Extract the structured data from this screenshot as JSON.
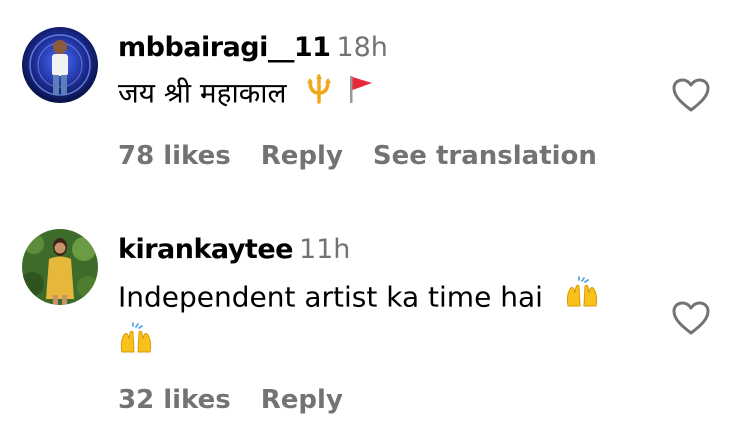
{
  "comments": [
    {
      "username": "mbbairagi__11",
      "time": "18h",
      "text": "जय श्री महाकाल",
      "likes": "78 likes",
      "reply": "Reply",
      "translate": "See translation",
      "emojis": [
        "trident-icon",
        "red-flag-icon"
      ]
    },
    {
      "username": "kirankaytee",
      "time": "11h",
      "text": "Independent artist ka time hai",
      "likes": "32 likes",
      "reply": "Reply",
      "emojis": [
        "raising-hands-icon",
        "raising-hands-icon"
      ]
    }
  ],
  "colors": {
    "muted": "#737373",
    "text": "#000000",
    "emoji_yellow": "#F9C21B",
    "flag_red": "#E8283B"
  }
}
